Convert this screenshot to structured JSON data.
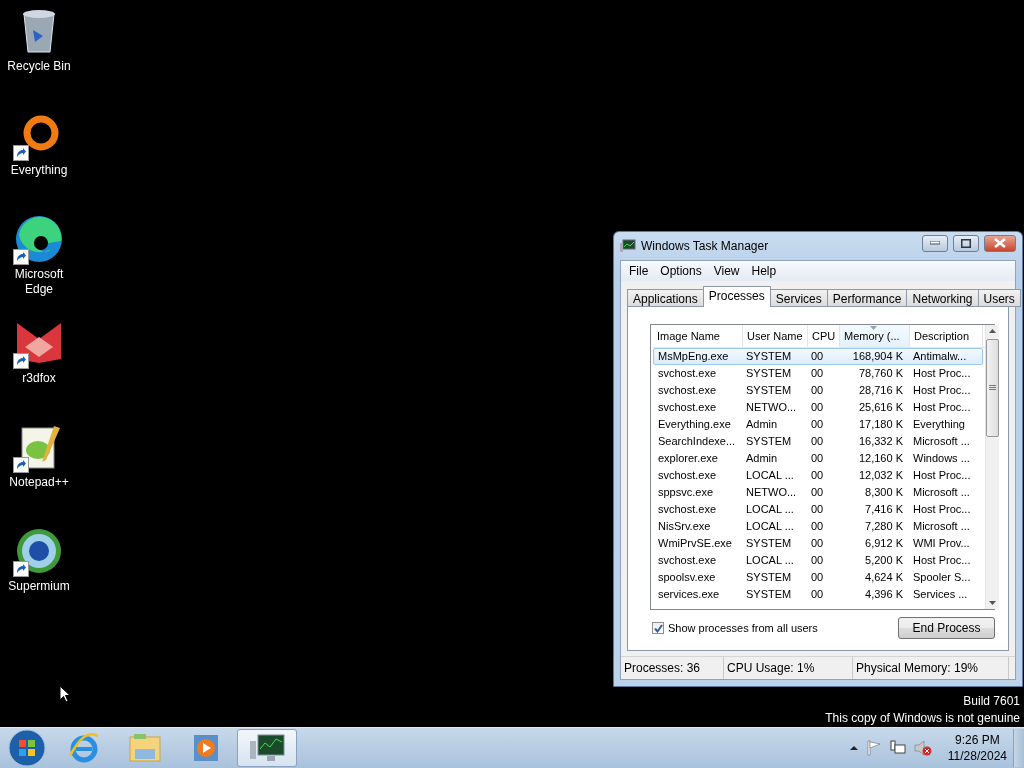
{
  "desktop_icons": [
    {
      "label": "Recycle Bin",
      "kind": "recycle",
      "shortcut": false
    },
    {
      "label": "Everything",
      "kind": "everything",
      "shortcut": true
    },
    {
      "label": "Microsoft Edge",
      "kind": "edge",
      "shortcut": true
    },
    {
      "label": "r3dfox",
      "kind": "r3dfox",
      "shortcut": true
    },
    {
      "label": "Notepad++",
      "kind": "notepad",
      "shortcut": true
    },
    {
      "label": "Supermium",
      "kind": "supermium",
      "shortcut": true
    }
  ],
  "window": {
    "title": "Windows Task Manager",
    "menu": [
      "File",
      "Options",
      "View",
      "Help"
    ],
    "tabs": [
      {
        "label": "Applications",
        "selected": false
      },
      {
        "label": "Processes",
        "selected": true
      },
      {
        "label": "Services",
        "selected": false
      },
      {
        "label": "Performance",
        "selected": false
      },
      {
        "label": "Networking",
        "selected": false
      },
      {
        "label": "Users",
        "selected": false
      }
    ],
    "table": {
      "columns": [
        {
          "label": "Image Name",
          "sorted": false
        },
        {
          "label": "User Name",
          "sorted": false
        },
        {
          "label": "CPU",
          "sorted": false
        },
        {
          "label": "Memory (...",
          "sorted": true
        },
        {
          "label": "Description",
          "sorted": false
        }
      ],
      "rows": [
        {
          "cells": [
            "MsMpEng.exe",
            "SYSTEM",
            "00",
            "168,904 K",
            "Antimalw..."
          ],
          "selected": true
        },
        {
          "cells": [
            "svchost.exe",
            "SYSTEM",
            "00",
            "78,760 K",
            "Host Proc..."
          ],
          "selected": false
        },
        {
          "cells": [
            "svchost.exe",
            "SYSTEM",
            "00",
            "28,716 K",
            "Host Proc..."
          ],
          "selected": false
        },
        {
          "cells": [
            "svchost.exe",
            "NETWO...",
            "00",
            "25,616 K",
            "Host Proc..."
          ],
          "selected": false
        },
        {
          "cells": [
            "Everything.exe",
            "Admin",
            "00",
            "17,180 K",
            "Everything"
          ],
          "selected": false
        },
        {
          "cells": [
            "SearchIndexe...",
            "SYSTEM",
            "00",
            "16,332 K",
            "Microsoft ..."
          ],
          "selected": false
        },
        {
          "cells": [
            "explorer.exe",
            "Admin",
            "00",
            "12,160 K",
            "Windows ..."
          ],
          "selected": false
        },
        {
          "cells": [
            "svchost.exe",
            "LOCAL ...",
            "00",
            "12,032 K",
            "Host Proc..."
          ],
          "selected": false
        },
        {
          "cells": [
            "sppsvc.exe",
            "NETWO...",
            "00",
            "8,300 K",
            "Microsoft ..."
          ],
          "selected": false
        },
        {
          "cells": [
            "svchost.exe",
            "LOCAL ...",
            "00",
            "7,416 K",
            "Host Proc..."
          ],
          "selected": false
        },
        {
          "cells": [
            "NisSrv.exe",
            "LOCAL ...",
            "00",
            "7,280 K",
            "Microsoft ..."
          ],
          "selected": false
        },
        {
          "cells": [
            "WmiPrvSE.exe",
            "SYSTEM",
            "00",
            "6,912 K",
            "WMI Prov..."
          ],
          "selected": false
        },
        {
          "cells": [
            "svchost.exe",
            "LOCAL ...",
            "00",
            "5,200 K",
            "Host Proc..."
          ],
          "selected": false
        },
        {
          "cells": [
            "spoolsv.exe",
            "SYSTEM",
            "00",
            "4,624 K",
            "Spooler S..."
          ],
          "selected": false
        },
        {
          "cells": [
            "services.exe",
            "SYSTEM",
            "00",
            "4,396 K",
            "Services ..."
          ],
          "selected": false
        }
      ]
    },
    "show_all_users": {
      "label": "Show processes from all users",
      "checked": true
    },
    "end_process_button": "End Process",
    "status_bar": [
      "Processes: 36",
      "CPU Usage: 1%",
      "Physical Memory: 19%"
    ]
  },
  "watermark": [
    "Build 7601",
    "This copy of Windows is not genuine"
  ],
  "taskbar": {
    "items": [
      {
        "kind": "ie",
        "active": false
      },
      {
        "kind": "explorer",
        "active": false
      },
      {
        "kind": "media",
        "active": false
      },
      {
        "kind": "taskmgr",
        "active": true
      }
    ],
    "clock": {
      "time": "9:26 PM",
      "date": "11/28/2024"
    }
  }
}
